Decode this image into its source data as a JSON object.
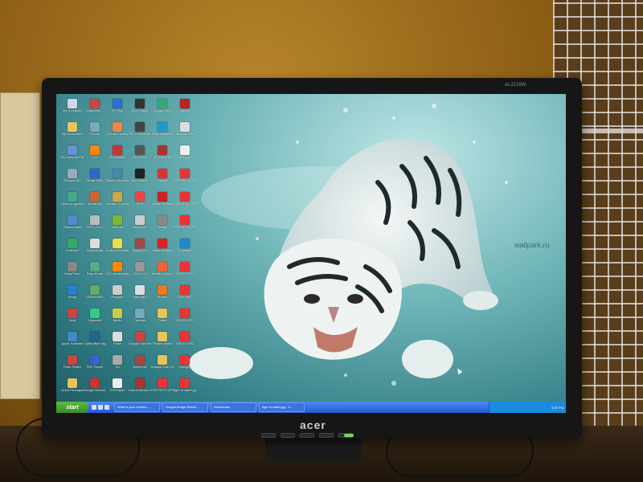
{
  "monitor": {
    "brand": "acer",
    "model": "AL2216W"
  },
  "wallpaper": {
    "watermark": "wallpark.ru",
    "accent": "#6fb5b8"
  },
  "desktop_icons": [
    {
      "label": "My Computer",
      "color": "#cfd6e6"
    },
    {
      "label": "Administr...",
      "color": "#c44"
    },
    {
      "label": "PC Plus",
      "color": "#2a6fd1"
    },
    {
      "label": "DivX Player",
      "color": "#333"
    },
    {
      "label": "Google Earth",
      "color": "#3a7"
    },
    {
      "label": "Adobe",
      "color": "#b22"
    },
    {
      "label": "My Documents",
      "color": "#e7c35a"
    },
    {
      "label": "iTunes",
      "color": "#7ab"
    },
    {
      "label": "Format Factory",
      "color": "#e84"
    },
    {
      "label": "DivX Converter",
      "color": "#444"
    },
    {
      "label": "Easy Uploader",
      "color": "#29c"
    },
    {
      "label": "attachments",
      "color": "#ddd"
    },
    {
      "label": "My Network Places",
      "color": "#6a8fd8"
    },
    {
      "label": "VLC",
      "color": "#f80"
    },
    {
      "label": "Shockwave",
      "color": "#c33"
    },
    {
      "label": "DivX Plus",
      "color": "#555"
    },
    {
      "label": "3D Recorder",
      "color": "#a33"
    },
    {
      "label": "file.jpg",
      "color": "#eee"
    },
    {
      "label": "Recycle Bin",
      "color": "#9ab"
    },
    {
      "label": "Smart Vista",
      "color": "#36c"
    },
    {
      "label": "Macro Converter",
      "color": "#48a"
    },
    {
      "label": "Bud Dancer",
      "color": "#222"
    },
    {
      "label": "SnagIt",
      "color": "#d33"
    },
    {
      "label": "DSCF5874.JPG",
      "color": "#e33"
    },
    {
      "label": "Other programs",
      "color": "#4a8"
    },
    {
      "label": "AdultHub",
      "color": "#c63"
    },
    {
      "label": "Ancient Converter",
      "color": "#ca4"
    },
    {
      "label": "Shot",
      "color": "#e44"
    },
    {
      "label": "Adobe Reader",
      "color": "#c22"
    },
    {
      "label": "DSCF5770.JPG",
      "color": "#e33"
    },
    {
      "label": "Stream data",
      "color": "#58c"
    },
    {
      "label": "OCR_2.4.0",
      "color": "#bbb"
    },
    {
      "label": "Android",
      "color": "#7b3"
    },
    {
      "label": "setup.exe",
      "color": "#ccc"
    },
    {
      "label": "Setup",
      "color": "#888"
    },
    {
      "label": "DSCF5775.JPG",
      "color": "#e33"
    },
    {
      "label": "OneDrive",
      "color": "#3a6"
    },
    {
      "label": "Documents",
      "color": "#ddd"
    },
    {
      "label": "Android Emulator",
      "color": "#ed4"
    },
    {
      "label": "MagicDisc",
      "color": "#a44"
    },
    {
      "label": "Adobe Reader",
      "color": "#d22"
    },
    {
      "label": "Universal",
      "color": "#28c"
    },
    {
      "label": "EasyPhoto",
      "color": "#888"
    },
    {
      "label": "Easy Photo",
      "color": "#5a8"
    },
    {
      "label": "VLC media player",
      "color": "#f80"
    },
    {
      "label": "OCR 2.4.0",
      "color": "#999"
    },
    {
      "label": "Mozilla Firefox",
      "color": "#e63"
    },
    {
      "label": "DSCF3.JPG",
      "color": "#e33"
    },
    {
      "label": "Setup",
      "color": "#2a7fd1"
    },
    {
      "label": "UWNIOSEK",
      "color": "#6a6"
    },
    {
      "label": "Program",
      "color": "#ccc"
    },
    {
      "label": "easy.mp3",
      "color": "#ddd"
    },
    {
      "label": "Firefox",
      "color": "#e72"
    },
    {
      "label": "DSC.JPG",
      "color": "#e33"
    },
    {
      "label": "Java",
      "color": "#c44"
    },
    {
      "label": "Uploader",
      "color": "#3c8"
    },
    {
      "label": "Music",
      "color": "#cc4"
    },
    {
      "label": "Transfer",
      "color": "#7ab"
    },
    {
      "label": "Folder",
      "color": "#e7c35a"
    },
    {
      "label": "DSCF5.JPG",
      "color": "#e33"
    },
    {
      "label": "Apple Software",
      "color": "#48c"
    },
    {
      "label": "OpenOffice.org",
      "color": "#268"
    },
    {
      "label": "Flash",
      "color": "#ddd"
    },
    {
      "label": "Google Chrome",
      "color": "#c44"
    },
    {
      "label": "Picture folder",
      "color": "#e7c35a"
    },
    {
      "label": "DSCF2.JPG",
      "color": "#e33"
    },
    {
      "label": "Flash Player",
      "color": "#c44"
    },
    {
      "label": "PDF Player",
      "color": "#36c"
    },
    {
      "label": "Tor",
      "color": "#aaa"
    },
    {
      "label": "driver.exe",
      "color": "#a44"
    },
    {
      "label": "Images from Internet",
      "color": "#e7c35a"
    },
    {
      "label": "test.jpg",
      "color": "#e33"
    },
    {
      "label": "Aerial Photography",
      "color": "#e7c35a"
    },
    {
      "label": "Google SketchUp 7",
      "color": "#c33"
    },
    {
      "label": "DVDStyler",
      "color": "#eee"
    },
    {
      "label": "Canon Media Center",
      "color": "#a33"
    },
    {
      "label": "DSCF5797.JPG",
      "color": "#e33"
    },
    {
      "label": "tiger in water.jpg",
      "color": "#e33"
    }
  ],
  "taskbar": {
    "start_label": "start",
    "tasks": [
      "What is your monitor ...",
      "Google Image Result ...",
      "Downloads",
      "tiger in water.jpg - Il..."
    ],
    "clock": "5:32 PM"
  }
}
